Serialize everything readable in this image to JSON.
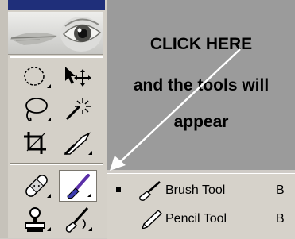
{
  "instruction": {
    "line1": "CLICK HERE",
    "line2": "and the tools will",
    "line3": "appear"
  },
  "toolbox": {
    "header_color": "#1f2f7a",
    "tools": [
      {
        "name": "elliptical-marquee-tool",
        "icon": "ellipse-marquee-icon"
      },
      {
        "name": "move-tool",
        "icon": "move-arrow-icon"
      },
      {
        "name": "lasso-tool",
        "icon": "lasso-icon"
      },
      {
        "name": "magic-wand-tool",
        "icon": "magic-wand-icon"
      },
      {
        "name": "crop-tool",
        "icon": "crop-icon"
      },
      {
        "name": "slice-tool",
        "icon": "slice-knife-icon"
      },
      {
        "name": "healing-brush-tool",
        "icon": "bandage-icon"
      },
      {
        "name": "brush-tool",
        "icon": "brush-icon",
        "active": true
      },
      {
        "name": "clone-stamp-tool",
        "icon": "stamp-icon"
      },
      {
        "name": "history-brush-tool",
        "icon": "history-brush-icon"
      }
    ]
  },
  "flyout": {
    "items": [
      {
        "label": "Brush Tool",
        "shortcut": "B",
        "selected": true,
        "icon": "brush-icon"
      },
      {
        "label": "Pencil Tool",
        "shortcut": "B",
        "selected": false,
        "icon": "pencil-icon"
      }
    ]
  }
}
